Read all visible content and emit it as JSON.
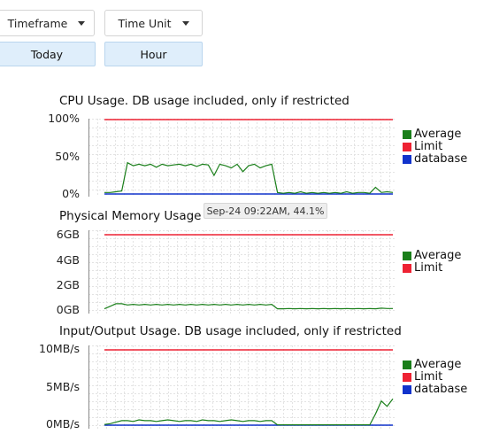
{
  "toolbar": {
    "timeframe_label": "Timeframe",
    "timeframe_value": "Today",
    "timeunit_label": "Time Unit",
    "timeunit_value": "Hour"
  },
  "colors": {
    "average": "#1a7f1a",
    "limit": "#ee2233",
    "database": "#1133cc",
    "grid": "#e3e3e3"
  },
  "tooltip": "Sep-24 09:22AM, 44.1%",
  "charts": [
    {
      "title": "CPU Usage. DB usage included, only if restricted",
      "ticks": [
        "100%",
        "50%",
        "0%"
      ],
      "legend": [
        "Average",
        "Limit",
        "database"
      ]
    },
    {
      "title": "Physical Memory Usage",
      "ticks": [
        "6GB",
        "4GB",
        "2GB",
        "0GB"
      ],
      "legend": [
        "Average",
        "Limit"
      ]
    },
    {
      "title": "Input/Output Usage. DB usage included, only if restricted",
      "ticks": [
        "10MB/s",
        "5MB/s",
        "0MB/s"
      ],
      "legend": [
        "Average",
        "Limit",
        "database"
      ]
    }
  ],
  "chart_data": [
    {
      "type": "line",
      "title": "CPU Usage. DB usage included, only if restricted",
      "ylim": [
        0,
        100
      ],
      "series": [
        {
          "name": "Average",
          "values": [
            2,
            2,
            3,
            4,
            42,
            38,
            40,
            38,
            40,
            36,
            40,
            38,
            39,
            40,
            38,
            40,
            37,
            40,
            39,
            25,
            40,
            38,
            35,
            40,
            30,
            38,
            40,
            35,
            38,
            40,
            2,
            1,
            2,
            1,
            3,
            1,
            2,
            1,
            2,
            1,
            2,
            1,
            3,
            1,
            2,
            2,
            1,
            9,
            2,
            3,
            2
          ]
        },
        {
          "name": "Limit",
          "values": [
            100,
            100
          ]
        },
        {
          "name": "database",
          "values": [
            0,
            0
          ]
        }
      ]
    },
    {
      "type": "line",
      "title": "Physical Memory Usage",
      "ylim": [
        0,
        6
      ],
      "series": [
        {
          "name": "Average",
          "values": [
            0.1,
            0.3,
            0.5,
            0.5,
            0.4,
            0.45,
            0.4,
            0.45,
            0.4,
            0.45,
            0.4,
            0.45,
            0.4,
            0.45,
            0.4,
            0.45,
            0.4,
            0.45,
            0.4,
            0.45,
            0.4,
            0.45,
            0.4,
            0.45,
            0.4,
            0.45,
            0.4,
            0.45,
            0.4,
            0.45,
            0.1,
            0.1,
            0.12,
            0.1,
            0.12,
            0.1,
            0.12,
            0.1,
            0.12,
            0.1,
            0.12,
            0.1,
            0.12,
            0.1,
            0.12,
            0.1,
            0.12,
            0.1,
            0.15,
            0.12,
            0.12
          ]
        },
        {
          "name": "Limit",
          "values": [
            6,
            6
          ]
        }
      ]
    },
    {
      "type": "line",
      "title": "Input/Output Usage. DB usage included, only if restricted",
      "ylim": [
        0,
        10
      ],
      "series": [
        {
          "name": "Average",
          "values": [
            0.1,
            0.2,
            0.4,
            0.6,
            0.6,
            0.5,
            0.7,
            0.6,
            0.6,
            0.5,
            0.6,
            0.7,
            0.6,
            0.5,
            0.6,
            0.6,
            0.5,
            0.7,
            0.6,
            0.6,
            0.5,
            0.6,
            0.7,
            0.6,
            0.5,
            0.6,
            0.6,
            0.5,
            0.6,
            0.6,
            0.05,
            0.05,
            0.05,
            0.05,
            0.05,
            0.05,
            0.05,
            0.05,
            0.05,
            0.05,
            0.05,
            0.05,
            0.05,
            0.05,
            0.05,
            0.05,
            0.05,
            1.5,
            3.2,
            2.5,
            3.5
          ]
        },
        {
          "name": "Limit",
          "values": [
            10,
            10
          ]
        },
        {
          "name": "database",
          "values": [
            0,
            0
          ]
        }
      ]
    }
  ]
}
